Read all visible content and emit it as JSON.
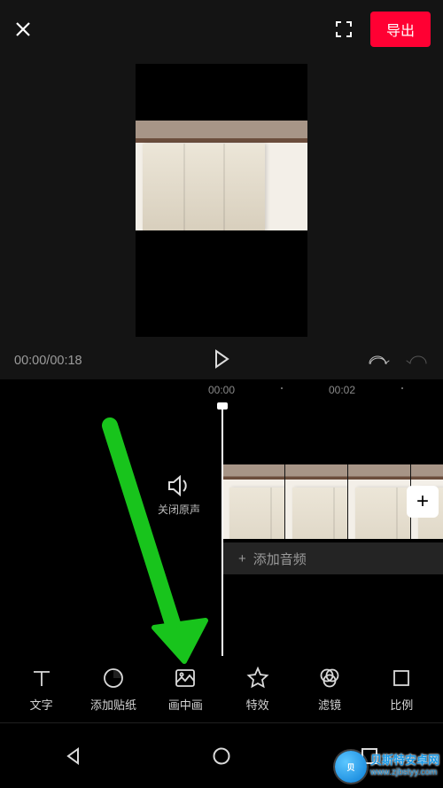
{
  "topbar": {
    "export_label": "导出"
  },
  "transport": {
    "time_display": "00:00/00:18"
  },
  "ruler": {
    "t0": "00:00",
    "t1": "00:02"
  },
  "timeline": {
    "mute_label": "关闭原声",
    "add_audio_label": "添加音频",
    "add_clip_glyph": "+",
    "add_audio_glyph": "+"
  },
  "toolbar": {
    "items": [
      {
        "key": "text",
        "label": "文字"
      },
      {
        "key": "sticker",
        "label": "添加贴纸"
      },
      {
        "key": "pip",
        "label": "画中画"
      },
      {
        "key": "effect",
        "label": "特效"
      },
      {
        "key": "filter",
        "label": "滤镜"
      },
      {
        "key": "ratio",
        "label": "比例"
      }
    ]
  },
  "watermark": {
    "badge_text": "贝",
    "line1": "贝斯特安卓网",
    "line2": "www.zjbstyy.com"
  }
}
